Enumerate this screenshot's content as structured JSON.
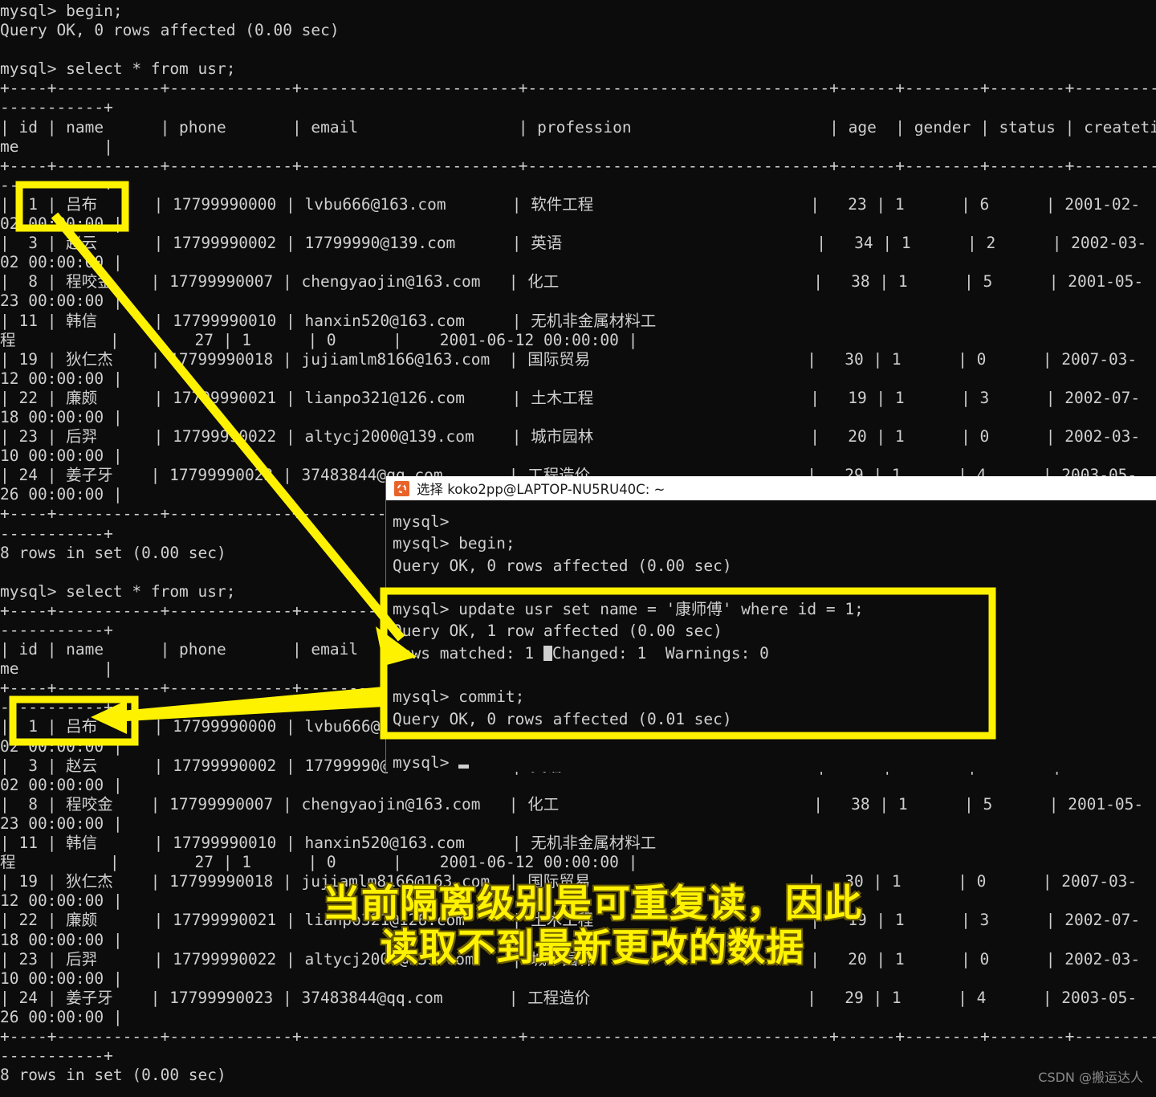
{
  "background_terminal": {
    "lines": [
      "mysql> begin;",
      "Query OK, 0 rows affected (0.00 sec)",
      "",
      "mysql> select * from usr;",
      "+----+-----------+-------------+-----------------------+--------------------------------+------+--------+--------+-----------",
      "-----------+",
      "| id | name      | phone       | email                 | profession                     | age  | gender | status | createti",
      "me         |",
      "+----+-----------+-------------+-----------------------+--------------------------------+------+--------+--------+-----------",
      "-----------+",
      "|  1 | 吕布      | 17799990000 | lvbu666@163.com       | 软件工程                       |   23 | 1      | 6      | 2001-02-",
      "02 00:00:00 |",
      "|  3 | 赵云      | 17799990002 | 17799990@139.com      | 英语                           |   34 | 1      | 2      | 2002-03-",
      "02 00:00:00 |",
      "|  8 | 程咬金    | 17799990007 | chengyaojin@163.com   | 化工                           |   38 | 1      | 5      | 2001-05-",
      "23 00:00:00 |",
      "| 11 | 韩信      | 17799990010 | hanxin520@163.com     | 无机非金属材料工",
      "程          |        27 | 1      | 0      |    2001-06-12 00:00:00 |",
      "| 19 | 狄仁杰    | 17799990018 | jujiamlm8166@163.com  | 国际贸易                       |   30 | 1      | 0      | 2007-03-",
      "12 00:00:00 |",
      "| 22 | 廉颇      | 17799990021 | lianpo321@126.com     | 土木工程                       |   19 | 1      | 3      | 2002-07-",
      "18 00:00:00 |",
      "| 23 | 后羿      | 17799990022 | altycj2000@139.com    | 城市园林                       |   20 | 1      | 0      | 2002-03-",
      "10 00:00:00 |",
      "| 24 | 姜子牙    | 17799990023 | 37483844@qq.com       | 工程造价                       |   29 | 1      | 4      | 2003-05-",
      "26 00:00:00 |",
      "+----+-----------+-------------+-----------------------+--------------------------------+------+--------+--------+-----------",
      "-----------+",
      "8 rows in set (0.00 sec)",
      "",
      "mysql> select * from usr;",
      "+----+-----------+-------------+-----------------------+--------------------------------+------+--------+--------+-----------",
      "-----------+",
      "| id | name      | phone       | email                 | profession                     | age  | gender | status | createti",
      "me         |",
      "+----+-----------+-------------+-----------------------+--------------------------------+------+--------+--------+-----------",
      "-----------+",
      "|  1 | 吕布      | 17799990000 | lvbu666@163.com       | 软件工程                       |   23 | 1      | 6      | 2001-02-",
      "02 00:00:00 |",
      "|  3 | 赵云      | 17799990002 | 17799990@139.com      | 英语                           |   34 | 1      | 2      | 2002-03-",
      "02 00:00:00 |",
      "|  8 | 程咬金    | 17799990007 | chengyaojin@163.com   | 化工                           |   38 | 1      | 5      | 2001-05-",
      "23 00:00:00 |",
      "| 11 | 韩信      | 17799990010 | hanxin520@163.com     | 无机非金属材料工",
      "程          |        27 | 1      | 0      |    2001-06-12 00:00:00 |",
      "| 19 | 狄仁杰    | 17799990018 | jujiamlm8166@163.com  | 国际贸易                       |   30 | 1      | 0      | 2007-03-",
      "12 00:00:00 |",
      "| 22 | 廉颇      | 17799990021 | lianpo321@126.com     | 土木工程                       |   19 | 1      | 3      | 2002-07-",
      "18 00:00:00 |",
      "| 23 | 后羿      | 17799990022 | altycj2000@139.com    | 城市园林                       |   20 | 1      | 0      | 2002-03-",
      "10 00:00:00 |",
      "| 24 | 姜子牙    | 17799990023 | 37483844@qq.com       | 工程造价                       |   29 | 1      | 4      | 2003-05-",
      "26 00:00:00 |",
      "+----+-----------+-------------+-----------------------+--------------------------------+------+--------+--------+-----------",
      "-----------+",
      "8 rows in set (0.00 sec)"
    ]
  },
  "overlay_window": {
    "title": "选择 koko2pp@LAPTOP-NU5RU40C: ~",
    "icon": "ubuntu-icon",
    "lines_before": [
      "mysql>",
      "mysql> begin;",
      "Query OK, 0 rows affected (0.00 sec)",
      ""
    ],
    "highlighted_block": {
      "line1": "mysql> update usr set name = '康师傅' where id = 1;",
      "line2": "Query OK, 1 row affected (0.00 sec)",
      "line3_pre": "Rows matched: 1 ",
      "line3_post": "Changed: 1  Warnings: 0",
      "line4": "",
      "line5": "mysql> commit;",
      "line6": "Query OK, 0 rows affected (0.01 sec)"
    },
    "prompt_line": "mysql> "
  },
  "annotation": {
    "line1": "当前隔离级别是可重复读，因此",
    "line2": "读取不到最新更改的数据",
    "highlight_color": "#fff200"
  },
  "watermark": {
    "text": "CSDN @搬运达人"
  }
}
